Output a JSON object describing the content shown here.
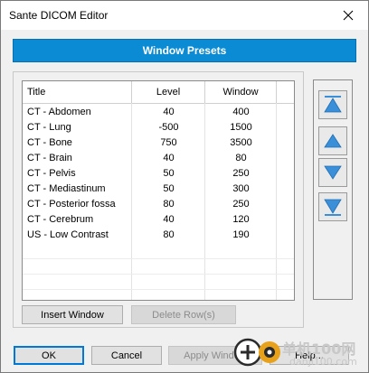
{
  "window": {
    "title": "Sante DICOM Editor"
  },
  "banner": {
    "label": "Window Presets"
  },
  "table": {
    "columns": [
      "Title",
      "Level",
      "Window"
    ],
    "rows": [
      [
        "CT - Abdomen",
        "40",
        "400"
      ],
      [
        "CT - Lung",
        "-500",
        "1500"
      ],
      [
        "CT - Bone",
        "750",
        "3500"
      ],
      [
        "CT - Brain",
        "40",
        "80"
      ],
      [
        "CT - Pelvis",
        "50",
        "250"
      ],
      [
        "CT - Mediastinum",
        "50",
        "300"
      ],
      [
        "CT - Posterior fossa",
        "80",
        "250"
      ],
      [
        "CT - Cerebrum",
        "40",
        "120"
      ],
      [
        "US - Low Contrast",
        "80",
        "190"
      ]
    ]
  },
  "buttons": {
    "insert_window": "Insert Window",
    "delete_rows": "Delete Row(s)",
    "ok": "OK",
    "cancel": "Cancel",
    "apply_window": "Apply Window",
    "help": "Help..."
  },
  "side_buttons": [
    "move-to-top-icon",
    "move-up-icon",
    "move-down-icon",
    "move-to-bottom-icon"
  ],
  "watermark": {
    "text_cn": "单机100网",
    "url": "danji100.com"
  },
  "colors": {
    "banner": "#0a8bd4",
    "arrow": "#3a8fd8"
  }
}
